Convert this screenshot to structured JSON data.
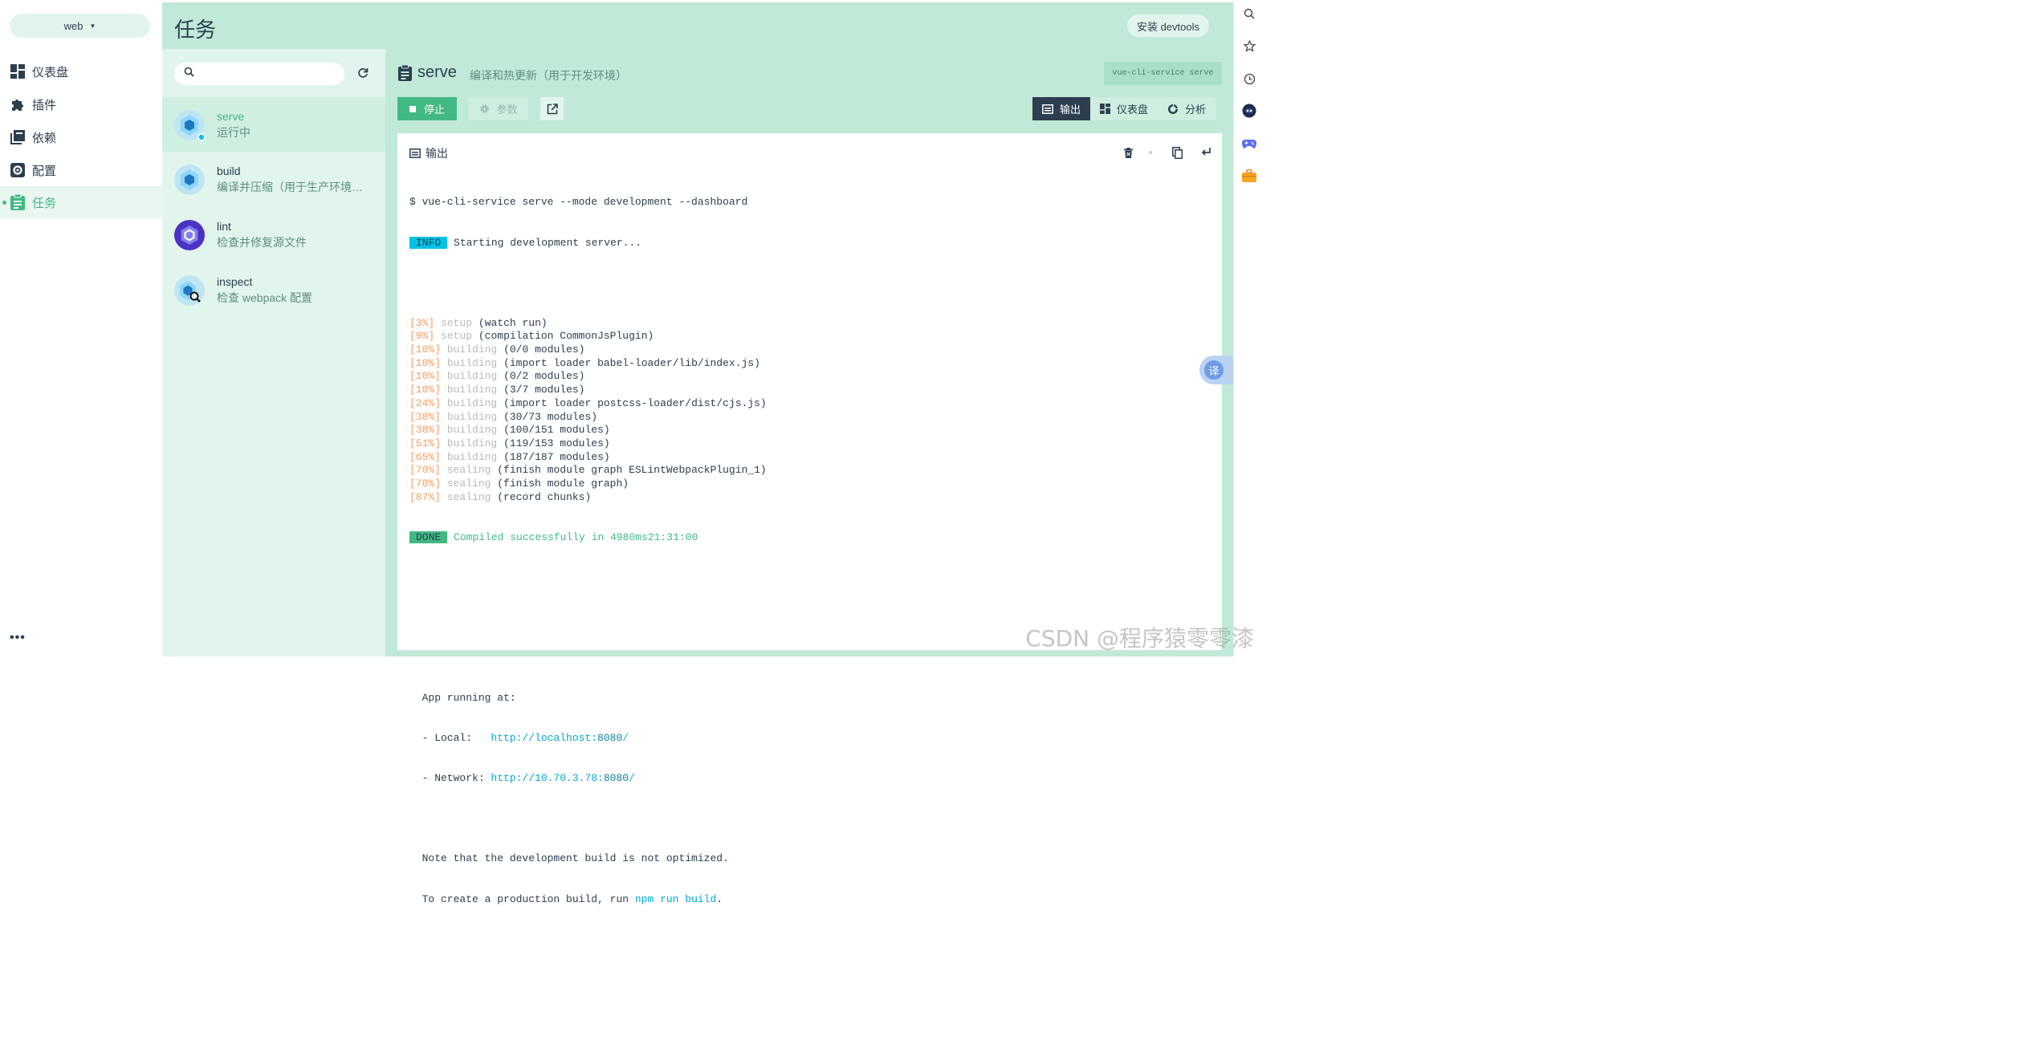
{
  "project": {
    "name": "web"
  },
  "nav": {
    "items": [
      {
        "label": "仪表盘",
        "icon": "dashboard-icon"
      },
      {
        "label": "插件",
        "icon": "puzzle-icon"
      },
      {
        "label": "依赖",
        "icon": "library-icon"
      },
      {
        "label": "配置",
        "icon": "gear-icon"
      },
      {
        "label": "任务",
        "icon": "clipboard-icon",
        "active": true
      }
    ],
    "more": "•••"
  },
  "header": {
    "title": "任务",
    "devtools_label": "安装 devtools"
  },
  "tasks": {
    "search_placeholder": "",
    "items": [
      {
        "name": "serve",
        "desc": "运行中",
        "selected": true
      },
      {
        "name": "build",
        "desc": "编译并压缩（用于生产环境…"
      },
      {
        "name": "lint",
        "desc": "检查并修复源文件"
      },
      {
        "name": "inspect",
        "desc": "检查 webpack 配置"
      }
    ]
  },
  "task_detail": {
    "title": "serve",
    "desc": "编译和热更新（用于开发环境）",
    "command": "vue-cli-service serve",
    "stop_label": "停止",
    "params_label": "参数",
    "tabs": [
      {
        "label": "输出",
        "active": true
      },
      {
        "label": "仪表盘"
      },
      {
        "label": "分析"
      }
    ]
  },
  "output": {
    "title": "输出",
    "lines": {
      "cmd": "$ vue-cli-service serve --mode development --dashboard",
      "info_tag": "INFO",
      "info_text": " Starting development server...",
      "progress": [
        {
          "pct": "[3%]",
          "step": "setup",
          "msg": "(watch run)"
        },
        {
          "pct": "[9%]",
          "step": "setup",
          "msg": "(compilation CommonJsPlugin)"
        },
        {
          "pct": "[10%]",
          "step": "building",
          "msg": "(0/0 modules)"
        },
        {
          "pct": "[10%]",
          "step": "building",
          "msg": "(import loader babel-loader/lib/index.js)"
        },
        {
          "pct": "[10%]",
          "step": "building",
          "msg": "(0/2 modules)"
        },
        {
          "pct": "[10%]",
          "step": "building",
          "msg": "(3/7 modules)"
        },
        {
          "pct": "[24%]",
          "step": "building",
          "msg": "(import loader postcss-loader/dist/cjs.js)"
        },
        {
          "pct": "[38%]",
          "step": "building",
          "msg": "(30/73 modules)"
        },
        {
          "pct": "[38%]",
          "step": "building",
          "msg": "(100/151 modules)"
        },
        {
          "pct": "[51%]",
          "step": "building",
          "msg": "(119/153 modules)"
        },
        {
          "pct": "[65%]",
          "step": "building",
          "msg": "(187/187 modules)"
        },
        {
          "pct": "[70%]",
          "step": "sealing",
          "msg": "(finish module graph ESLintWebpackPlugin_1)"
        },
        {
          "pct": "[70%]",
          "step": "sealing",
          "msg": "(finish module graph)"
        },
        {
          "pct": "[87%]",
          "step": "sealing",
          "msg": "(record chunks)"
        }
      ],
      "done_tag": "DONE",
      "done_text": " Compiled successfully in 4980ms21:31:00",
      "app_running": "  App running at:",
      "local_label": "  - Local:   ",
      "local_url": "http://localhost:",
      "local_port": "8080",
      "local_slash": "/",
      "network_label": "  - Network: ",
      "network_url": "http://10.70.3.78:",
      "network_port": "8080",
      "network_slash": "/",
      "note1": "  Note that the development build is not optimized.",
      "note2_pre": "  To create a production build, run ",
      "note2_cmd": "npm run build",
      "note2_post": "."
    }
  },
  "browser": {
    "translate": "译"
  },
  "watermark": "CSDN @程序猿零零漆",
  "colors": {
    "accent": "#42b983",
    "panel": "#c1e9d8",
    "dark": "#2c3e50",
    "info": "#03c2e6"
  }
}
